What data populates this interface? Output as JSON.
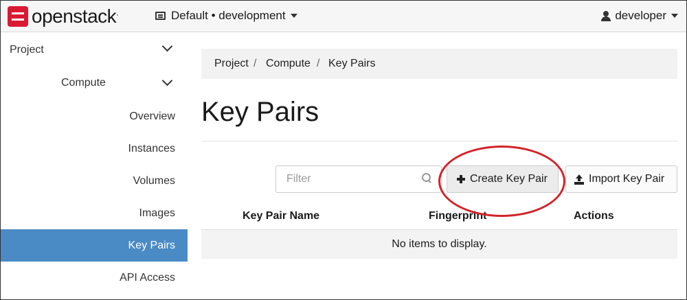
{
  "brand": {
    "name": "openstack",
    "mark": "."
  },
  "navbar": {
    "project_selector": "Default • development",
    "user": "developer"
  },
  "sidebar": {
    "project": "Project",
    "compute": "Compute",
    "items": [
      {
        "label": "Overview",
        "active": false
      },
      {
        "label": "Instances",
        "active": false
      },
      {
        "label": "Volumes",
        "active": false
      },
      {
        "label": "Images",
        "active": false
      },
      {
        "label": "Key Pairs",
        "active": true
      },
      {
        "label": "API Access",
        "active": false
      }
    ]
  },
  "breadcrumb": [
    "Project",
    "Compute",
    "Key Pairs"
  ],
  "page_title": "Key Pairs",
  "toolbar": {
    "filter_placeholder": "Filter",
    "create_label": "Create Key Pair",
    "import_label": "Import Key Pair"
  },
  "table": {
    "columns": [
      "Key Pair Name",
      "Fingerprint",
      "Actions"
    ],
    "empty_text": "No items to display."
  },
  "colors": {
    "accent": "#4a8ac5",
    "brand_red": "#da1a32",
    "annotation_ring": "#d2232a"
  }
}
